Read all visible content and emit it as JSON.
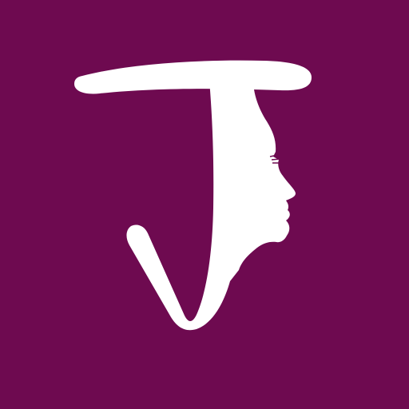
{
  "app_icon": {
    "name": "app-logo",
    "background_color": "#6e0a50",
    "glyph_color": "#ffffff",
    "glyph_letter": "J",
    "motif": "woman-face-profile-icon"
  }
}
